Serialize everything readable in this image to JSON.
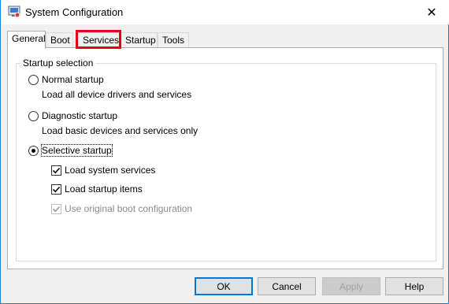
{
  "window": {
    "title": "System Configuration",
    "close_glyph": "✕",
    "app_icon": "msconfig-icon"
  },
  "tabs": [
    {
      "label": "General",
      "active": true
    },
    {
      "label": "Boot",
      "active": false
    },
    {
      "label": "Services",
      "active": false,
      "highlighted": true
    },
    {
      "label": "Startup",
      "active": false
    },
    {
      "label": "Tools",
      "active": false
    }
  ],
  "startup_selection": {
    "legend": "Startup selection",
    "normal": {
      "label": "Normal startup",
      "description": "Load all device drivers and services",
      "checked": false
    },
    "diagnostic": {
      "label": "Diagnostic startup",
      "description": "Load basic devices and services only",
      "checked": false
    },
    "selective": {
      "label": "Selective startup",
      "checked": true,
      "options": [
        {
          "label": "Load system services",
          "checked": true,
          "enabled": true
        },
        {
          "label": "Load startup items",
          "checked": true,
          "enabled": true
        },
        {
          "label": "Use original boot configuration",
          "checked": true,
          "enabled": false
        }
      ]
    }
  },
  "buttons": {
    "ok": "OK",
    "cancel": "Cancel",
    "apply": "Apply",
    "help": "Help"
  },
  "colors": {
    "highlight_box": "#e3001b",
    "default_button_border": "#0078d7"
  }
}
